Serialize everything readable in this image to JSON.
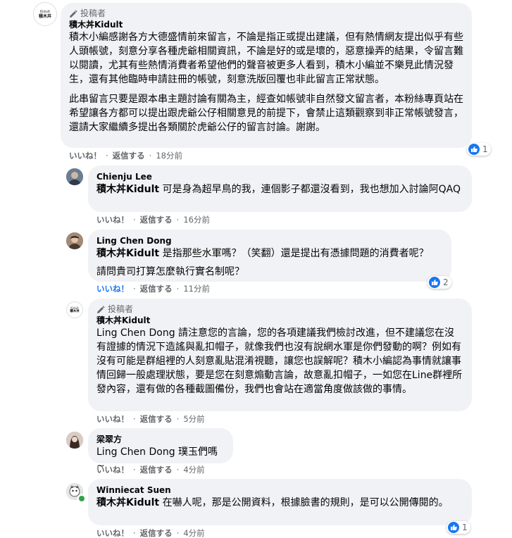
{
  "comments": [
    {
      "badge": "投稿者",
      "author": "積木丼Kidult",
      "paragraphs": [
        "積木小編感謝各方大德盛情前來留言，不論是指正或提出建議，但有熱情網友提出似乎有些人頭帳號，刻意分享各種虎爺相關資訊，不論是好的或是壞的，惡意操弄的結果，令留言難以閱讀，尤其有些熱情消費者希望他們的聲音被更多人看到，積木小編並不樂見此情況發生，還有其他臨時申請註冊的帳號，刻意洗版回覆也非此留言正常狀態。",
        "此串留言只要是跟本串主題討論有關為主，經查如帳號非自然發文留言者，本粉絲專頁站在希望讓各方都可以提出跟虎爺公仔相關意見的前提下，會禁止這類觀察到非正常帳號發言，還請大家繼續多提出各類關於虎爺公仔的留言討論。謝謝。"
      ],
      "like": "いいね！",
      "reply": "返信する",
      "time": "18分前",
      "reaction_count": "1",
      "logo_top": "Kidult",
      "logo_bottom": "積木丼"
    },
    {
      "author": "Chienju Lee",
      "mention": "積木丼Kidult",
      "text": " 可是身為超早鳥的我，連個影子都還沒看到，我也想加入討論阿QAQ",
      "like": "いいね！",
      "reply": "返信する",
      "time": "16分前"
    },
    {
      "author": "Ling Chen Dong",
      "mention": "積木丼Kidult",
      "text": " 是指那些水軍嗎？（笑翻）還是提出有憑據問題的消費者呢？",
      "text2": "請問貴司打算怎麼執行實名制呢？",
      "like": "いいね！",
      "reply": "返信する",
      "time": "11分前",
      "reaction_count": "2"
    },
    {
      "badge": "投稿者",
      "author": "積木丼Kidult",
      "text": "Ling Chen Dong 請注意您的言論，您的各項建議我們檢討改進，但不建議您在沒有證據的情況下造謠與亂扣帽子，就像我們也沒有說網水軍是你們發動的啊？例如有沒有可能是群組裡的人刻意亂貼混淆視聽，讓您也誤解呢？積木小編認為事情就讓事情回歸一般處理狀態，要是您在刻意煽動言論，故意亂扣帽子，一如您在Line群裡所發內容，還有做的各種截圖備份，我們也會站在適當角度做該做的事情。",
      "like": "いいね！",
      "reply": "返信する",
      "time": "5分前",
      "logo_top": "Kidult",
      "logo_bottom": "積木丼"
    },
    {
      "author": "梁翠方",
      "mention": "Ling Chen Dong",
      "text": " 璞玉們嗎~",
      "like": "いいね！",
      "reply": "返信する",
      "time": "4分前"
    },
    {
      "author": "Winniecat Suen",
      "mention": "積木丼Kidult",
      "text": " 在嚇人呢，那是公開資料，根據臉書的規則，是可以公開傳閱的。",
      "like": "いいね！",
      "reply": "返信する",
      "time": "4分前",
      "reaction_count": "1"
    }
  ],
  "colors": {
    "bubble": "#f0f2f5",
    "accent": "#1877f2",
    "meta": "#65676b"
  }
}
